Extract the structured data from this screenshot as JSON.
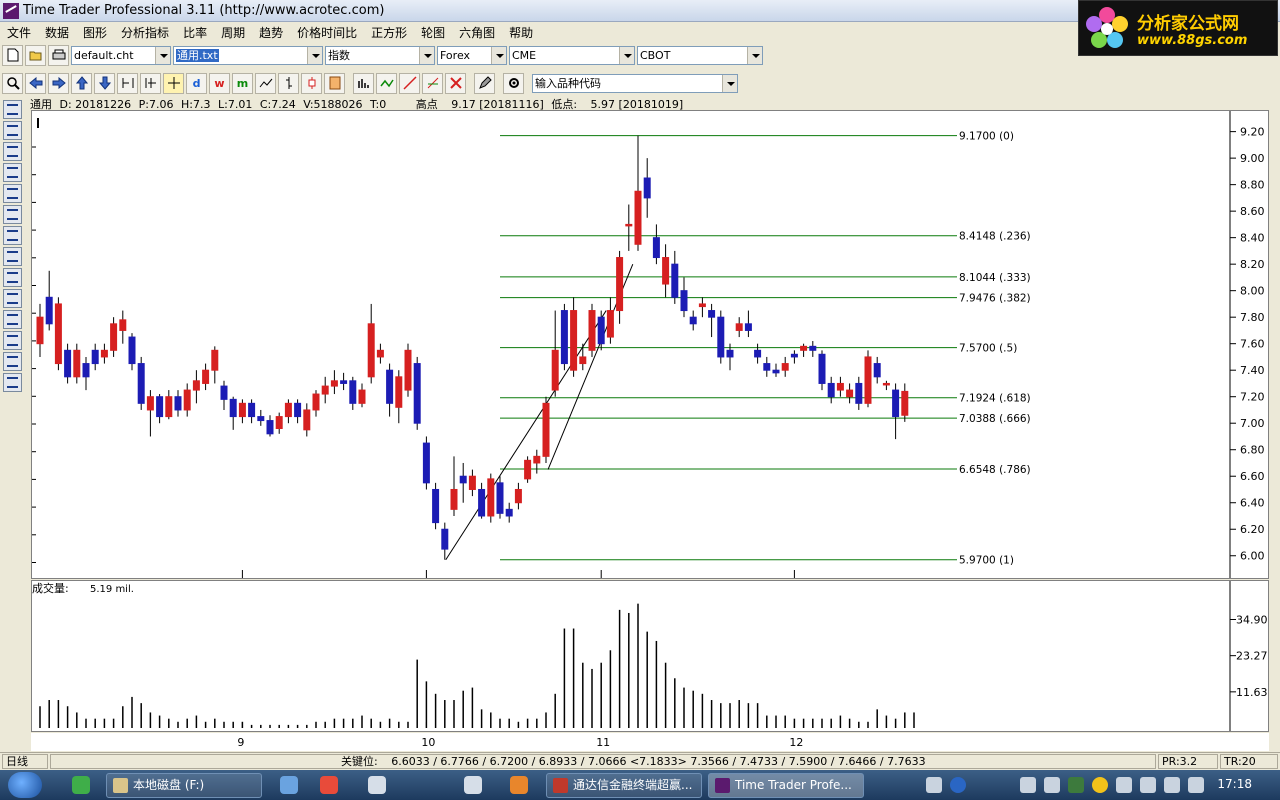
{
  "window": {
    "title": "Time Trader Professional 3.11 (http://www.acrotec.com)"
  },
  "logo": {
    "text_cn": "分析家公式网",
    "text_url": "www.88gs.com"
  },
  "menu": [
    "文件",
    "数据",
    "图形",
    "分析指标",
    "比率",
    "周期",
    "趋势",
    "价格时间比",
    "正方形",
    "轮图",
    "六角图",
    "帮助"
  ],
  "toolbar": {
    "chart_file": "default.cht",
    "symbol_file": "通用.txt",
    "index_type": "指数",
    "market": "Forex",
    "exchange1": "CME",
    "exchange2": "CBOT",
    "code_input": "输入品种代码"
  },
  "info": {
    "name": "通用",
    "date": "D: 20181226",
    "open": "P:7.06",
    "high": "H:7.3",
    "low": "L:7.01",
    "close": "C:7.24",
    "volume": "V:5188026",
    "t": "T:0",
    "high_label": "高点",
    "high_value": "9.17 [20181116]",
    "low_label": "低点:",
    "low_value": "5.97 [20181019]"
  },
  "volume_panel": {
    "label": "成交量:",
    "value": "5.19 mil."
  },
  "status": {
    "period": "日线",
    "key_label": "关键位:",
    "key_values": "6.6033 / 6.7766 / 6.7200 / 6.8933 / 7.0666 <7.1833> 7.3566 / 7.4733 / 7.5900 / 7.6466 / 7.7633",
    "pr": "PR:3.2",
    "tr": "TR:20"
  },
  "taskbar": {
    "tasks": [
      "本地磁盘 (F:)",
      "通达信金融终端超赢...",
      "Time Trader Profe..."
    ],
    "clock": "17:18"
  },
  "colors": {
    "up": "#d62020",
    "down": "#1c1cb4",
    "fib_line": "#0a7a0a",
    "vol_bar": "#000000"
  },
  "chart_data": {
    "type": "candlestick",
    "price_axis": {
      "ylim": [
        5.9,
        9.25
      ],
      "ticks": [
        "9.20",
        "9.00",
        "8.80",
        "8.60",
        "8.40",
        "8.20",
        "8.00",
        "7.80",
        "7.60",
        "7.40",
        "7.20",
        "7.00",
        "6.80",
        "6.60",
        "6.40",
        "6.20",
        "6.00"
      ]
    },
    "x_labels": [
      {
        "label": "9",
        "index": 22
      },
      {
        "label": "10",
        "index": 42
      },
      {
        "label": "11",
        "index": 61
      },
      {
        "label": "12",
        "index": 82
      }
    ],
    "fib_levels": [
      {
        "price": 9.17,
        "label": "9.1700  (0)"
      },
      {
        "price": 8.4148,
        "label": "8.4148  (.236)"
      },
      {
        "price": 8.1044,
        "label": "8.1044  (.333)"
      },
      {
        "price": 7.9476,
        "label": "7.9476  (.382)"
      },
      {
        "price": 7.57,
        "label": "7.5700  (.5)"
      },
      {
        "price": 7.1924,
        "label": "7.1924  (.618)"
      },
      {
        "price": 7.0388,
        "label": "7.0388  (.666)"
      },
      {
        "price": 6.6548,
        "label": "6.6548  (.786)"
      },
      {
        "price": 5.97,
        "label": "5.9700  (1)"
      }
    ],
    "candles": [
      [
        7.6,
        7.8,
        7.9,
        7.5
      ],
      [
        7.95,
        7.75,
        8.15,
        7.7
      ],
      [
        7.45,
        7.9,
        7.95,
        7.4
      ],
      [
        7.55,
        7.35,
        7.6,
        7.3
      ],
      [
        7.35,
        7.55,
        7.6,
        7.3
      ],
      [
        7.45,
        7.35,
        7.5,
        7.25
      ],
      [
        7.55,
        7.45,
        7.6,
        7.4
      ],
      [
        7.5,
        7.55,
        7.6,
        7.45
      ],
      [
        7.55,
        7.75,
        7.8,
        7.5
      ],
      [
        7.7,
        7.78,
        7.85,
        7.6
      ],
      [
        7.65,
        7.45,
        7.68,
        7.4
      ],
      [
        7.45,
        7.15,
        7.5,
        7.1
      ],
      [
        7.1,
        7.2,
        7.25,
        6.9
      ],
      [
        7.2,
        7.05,
        7.22,
        7.0
      ],
      [
        7.05,
        7.2,
        7.25,
        7.03
      ],
      [
        7.2,
        7.1,
        7.25,
        7.05
      ],
      [
        7.1,
        7.25,
        7.3,
        7.05
      ],
      [
        7.25,
        7.32,
        7.4,
        7.15
      ],
      [
        7.3,
        7.4,
        7.45,
        7.25
      ],
      [
        7.4,
        7.55,
        7.58,
        7.3
      ],
      [
        7.28,
        7.18,
        7.32,
        7.1
      ],
      [
        7.18,
        7.05,
        7.2,
        6.95
      ],
      [
        7.05,
        7.15,
        7.18,
        7.0
      ],
      [
        7.15,
        7.05,
        7.18,
        7.0
      ],
      [
        7.05,
        7.02,
        7.1,
        6.98
      ],
      [
        7.02,
        6.92,
        7.06,
        6.9
      ],
      [
        6.96,
        7.05,
        7.08,
        6.92
      ],
      [
        7.05,
        7.15,
        7.18,
        7.0
      ],
      [
        7.15,
        7.05,
        7.18,
        7.0
      ],
      [
        6.95,
        7.1,
        7.15,
        6.9
      ],
      [
        7.1,
        7.22,
        7.25,
        7.05
      ],
      [
        7.22,
        7.28,
        7.35,
        7.15
      ],
      [
        7.28,
        7.32,
        7.4,
        7.22
      ],
      [
        7.32,
        7.3,
        7.38,
        7.25
      ],
      [
        7.32,
        7.15,
        7.35,
        7.1
      ],
      [
        7.15,
        7.25,
        7.3,
        7.12
      ],
      [
        7.35,
        7.75,
        7.9,
        7.3
      ],
      [
        7.5,
        7.55,
        7.6,
        7.45
      ],
      [
        7.4,
        7.15,
        7.45,
        7.05
      ],
      [
        7.12,
        7.35,
        7.4,
        7.0
      ],
      [
        7.25,
        7.55,
        7.6,
        7.2
      ],
      [
        7.45,
        7.0,
        7.5,
        6.95
      ],
      [
        6.85,
        6.55,
        6.9,
        6.5
      ],
      [
        6.5,
        6.25,
        6.55,
        6.2
      ],
      [
        6.2,
        6.05,
        6.25,
        5.97
      ],
      [
        6.35,
        6.5,
        6.75,
        6.3
      ],
      [
        6.6,
        6.55,
        6.7,
        6.4
      ],
      [
        6.5,
        6.6,
        6.65,
        6.45
      ],
      [
        6.5,
        6.3,
        6.55,
        6.28
      ],
      [
        6.3,
        6.58,
        6.62,
        6.25
      ],
      [
        6.55,
        6.32,
        6.6,
        6.28
      ],
      [
        6.35,
        6.3,
        6.4,
        6.25
      ],
      [
        6.4,
        6.5,
        6.55,
        6.35
      ],
      [
        6.58,
        6.72,
        6.75,
        6.55
      ],
      [
        6.7,
        6.75,
        6.8,
        6.62
      ],
      [
        6.75,
        7.15,
        7.2,
        6.7
      ],
      [
        7.25,
        7.55,
        7.85,
        7.2
      ],
      [
        7.85,
        7.45,
        7.9,
        7.4
      ],
      [
        7.4,
        7.85,
        7.95,
        7.35
      ],
      [
        7.45,
        7.5,
        7.6,
        7.4
      ],
      [
        7.55,
        7.85,
        7.9,
        7.5
      ],
      [
        7.8,
        7.6,
        7.85,
        7.55
      ],
      [
        7.65,
        7.85,
        7.95,
        7.6
      ],
      [
        7.85,
        8.25,
        8.3,
        7.75
      ],
      [
        8.5,
        8.5,
        8.65,
        8.3
      ],
      [
        8.35,
        8.75,
        9.17,
        8.3
      ],
      [
        8.85,
        8.7,
        9.0,
        8.55
      ],
      [
        8.4,
        8.25,
        8.5,
        8.2
      ],
      [
        8.05,
        8.25,
        8.35,
        7.95
      ],
      [
        8.2,
        7.95,
        8.3,
        7.9
      ],
      [
        8.0,
        7.85,
        8.1,
        7.8
      ],
      [
        7.8,
        7.75,
        7.85,
        7.7
      ],
      [
        7.88,
        7.9,
        7.95,
        7.8
      ],
      [
        7.85,
        7.8,
        7.9,
        7.65
      ],
      [
        7.8,
        7.5,
        7.85,
        7.45
      ],
      [
        7.55,
        7.5,
        7.6,
        7.4
      ],
      [
        7.7,
        7.75,
        7.8,
        7.65
      ],
      [
        7.75,
        7.7,
        7.85,
        7.65
      ],
      [
        7.55,
        7.5,
        7.6,
        7.45
      ],
      [
        7.45,
        7.4,
        7.5,
        7.35
      ],
      [
        7.4,
        7.38,
        7.45,
        7.35
      ],
      [
        7.4,
        7.45,
        7.5,
        7.35
      ],
      [
        7.52,
        7.5,
        7.55,
        7.45
      ],
      [
        7.55,
        7.58,
        7.6,
        7.5
      ],
      [
        7.58,
        7.55,
        7.62,
        7.5
      ],
      [
        7.52,
        7.3,
        7.55,
        7.25
      ],
      [
        7.3,
        7.2,
        7.35,
        7.15
      ],
      [
        7.25,
        7.3,
        7.35,
        7.2
      ],
      [
        7.2,
        7.25,
        7.3,
        7.15
      ],
      [
        7.3,
        7.15,
        7.35,
        7.1
      ],
      [
        7.15,
        7.5,
        7.55,
        7.12
      ],
      [
        7.45,
        7.35,
        7.5,
        7.3
      ],
      [
        7.3,
        7.3,
        7.32,
        7.25
      ],
      [
        7.25,
        7.05,
        7.3,
        6.88
      ],
      [
        7.06,
        7.24,
        7.3,
        7.01
      ]
    ],
    "volume_axis": {
      "ylim": [
        0,
        46
      ],
      "ticks": [
        "34.90",
        "23.27",
        "11.63"
      ]
    },
    "volumes": [
      7,
      9,
      9,
      7,
      5,
      3,
      3,
      3,
      3,
      7,
      10,
      8,
      5,
      4,
      3,
      2,
      3,
      4,
      2,
      3,
      2,
      2,
      2,
      1,
      1,
      1,
      1,
      1,
      1,
      1,
      2,
      2,
      3,
      3,
      3,
      4,
      3,
      2,
      3,
      2,
      2,
      22,
      15,
      11,
      9,
      9,
      12,
      13,
      6,
      5,
      3,
      3,
      2,
      3,
      3,
      5,
      11,
      32,
      32,
      21,
      19,
      21,
      25,
      38,
      37,
      40,
      31,
      28,
      21,
      16,
      13,
      12,
      11,
      9,
      8,
      8,
      9,
      8,
      8,
      4,
      4,
      4,
      3,
      3,
      3,
      3,
      3,
      4,
      3,
      2,
      2,
      6,
      4,
      3,
      5,
      5
    ]
  }
}
